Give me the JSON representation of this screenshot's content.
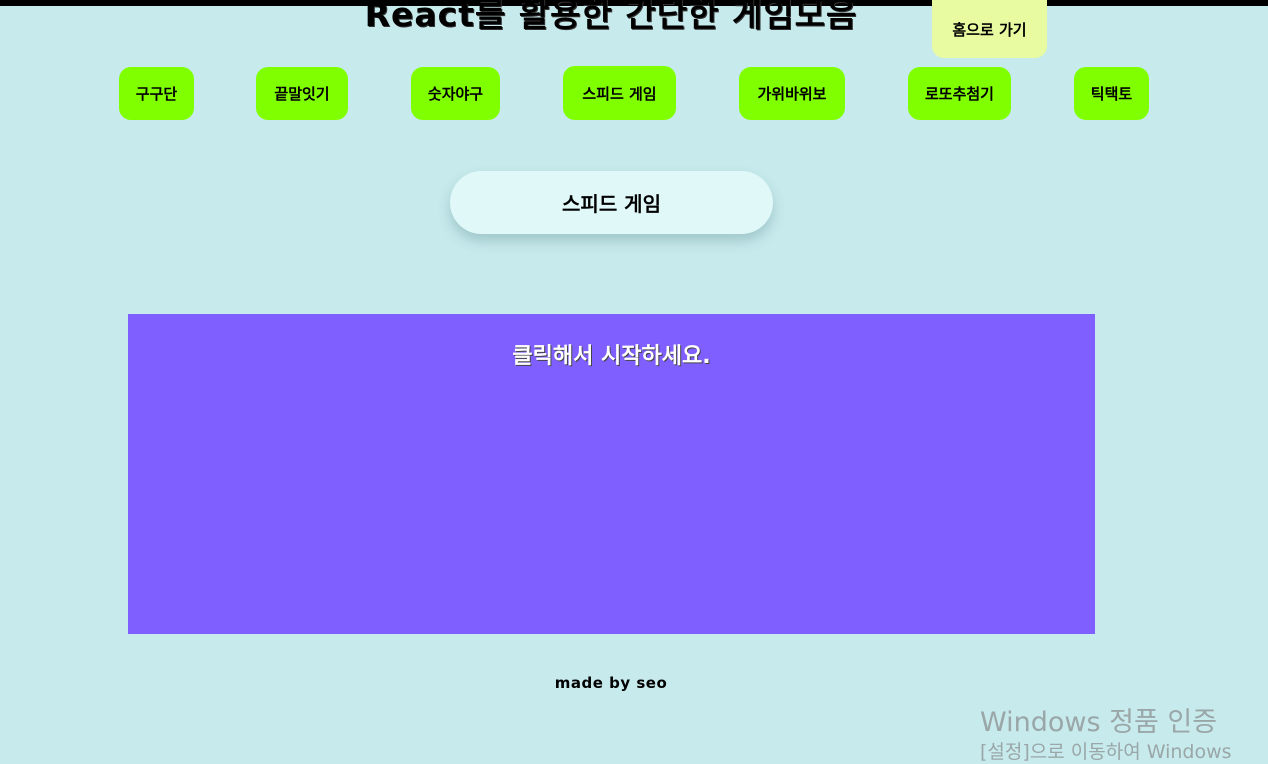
{
  "header": {
    "title": "React를 활용한 간단한 게임모음",
    "home_label": "홈으로 가기"
  },
  "nav": {
    "items": [
      {
        "label": "구구단"
      },
      {
        "label": "끝말잇기"
      },
      {
        "label": "숫자야구"
      },
      {
        "label": "스피드 게임"
      },
      {
        "label": "가위바위보"
      },
      {
        "label": "로또추첨기"
      },
      {
        "label": "틱택토"
      }
    ]
  },
  "game": {
    "title": "스피드 게임",
    "screen_message": "클릭해서 시작하세요.",
    "screen_color": "#7f5fff"
  },
  "footer": {
    "text": "made by seo"
  },
  "watermark": {
    "title": "Windows 정품 인증",
    "subtitle": "[설정]으로 이동하여 Windows"
  },
  "colors": {
    "background": "#c7eaec",
    "nav_button": "#80ff00",
    "home_button": "#e9fba0",
    "title_pill": "#e1f8f9"
  }
}
